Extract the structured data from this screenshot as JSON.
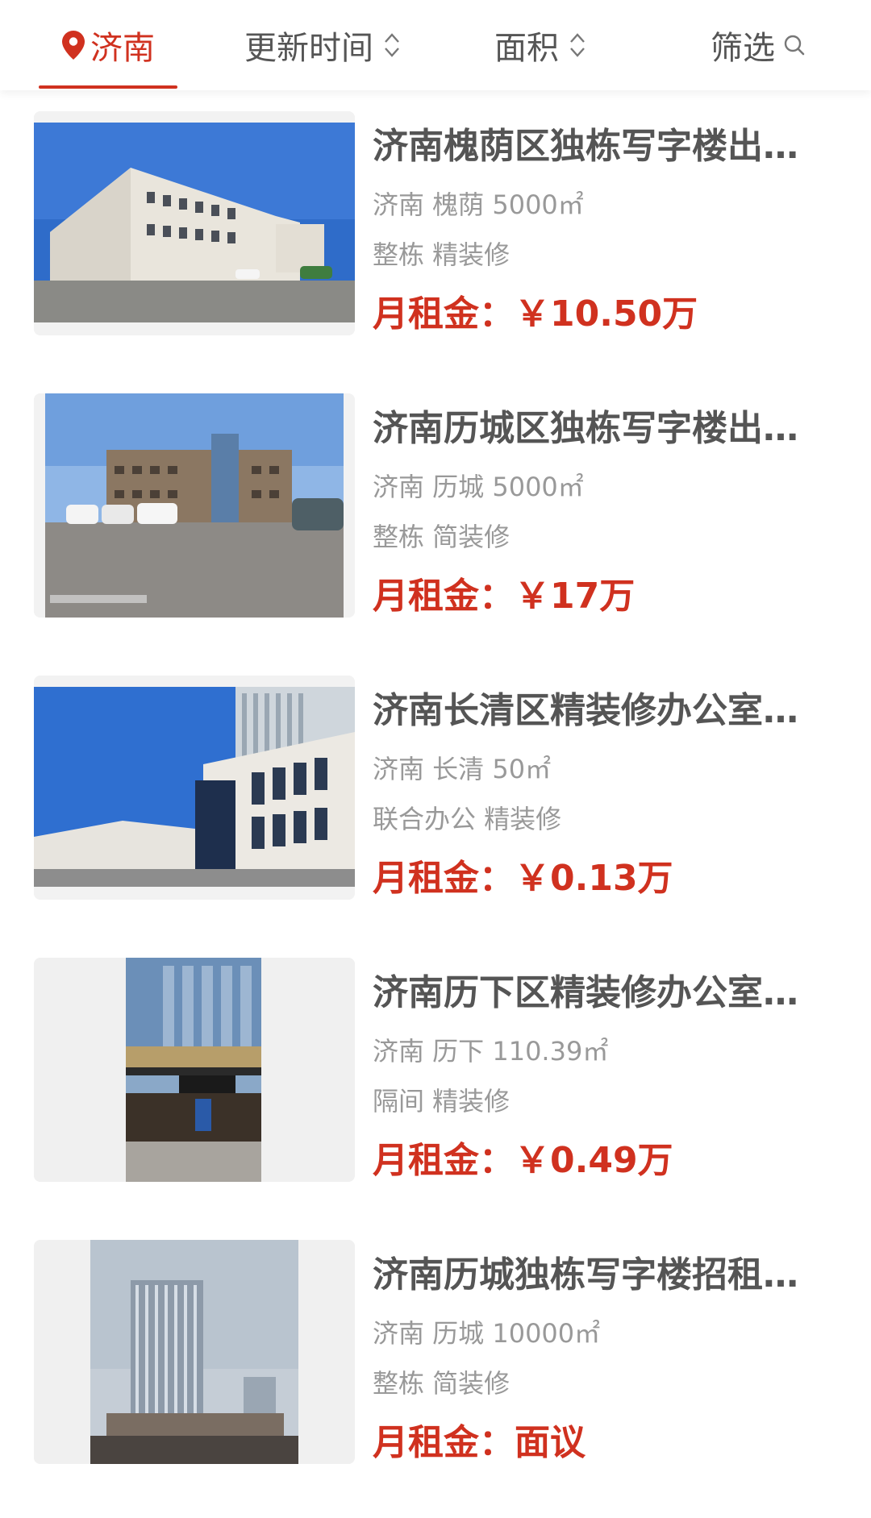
{
  "tabs": {
    "city": "济南",
    "update_time": "更新时间",
    "area": "面积",
    "filter": "筛选"
  },
  "colors": {
    "accent": "#d0311f",
    "text_primary": "#555555",
    "text_secondary": "#999999"
  },
  "listings": [
    {
      "title": "济南槐荫区独栋写字楼出…",
      "meta": "济南 槐荫 5000㎡",
      "tags": "整栋 精装修",
      "price_label": "月租金：",
      "price_value": "￥10.50万"
    },
    {
      "title": "济南历城区独栋写字楼出…",
      "meta": "济南 历城 5000㎡",
      "tags": "整栋 简装修",
      "price_label": "月租金：",
      "price_value": "￥17万"
    },
    {
      "title": "济南长清区精装修办公室…",
      "meta": "济南 长清 50㎡",
      "tags": "联合办公 精装修",
      "price_label": "月租金：",
      "price_value": "￥0.13万"
    },
    {
      "title": "济南历下区精装修办公室…",
      "meta": "济南 历下 110.39㎡",
      "tags": "隔间 精装修",
      "price_label": "月租金：",
      "price_value": "￥0.49万"
    },
    {
      "title": "济南历城独栋写字楼招租…",
      "meta": "济南 历城 10000㎡",
      "tags": "整栋 简装修",
      "price_label": "月租金：",
      "price_value": "面议"
    }
  ]
}
